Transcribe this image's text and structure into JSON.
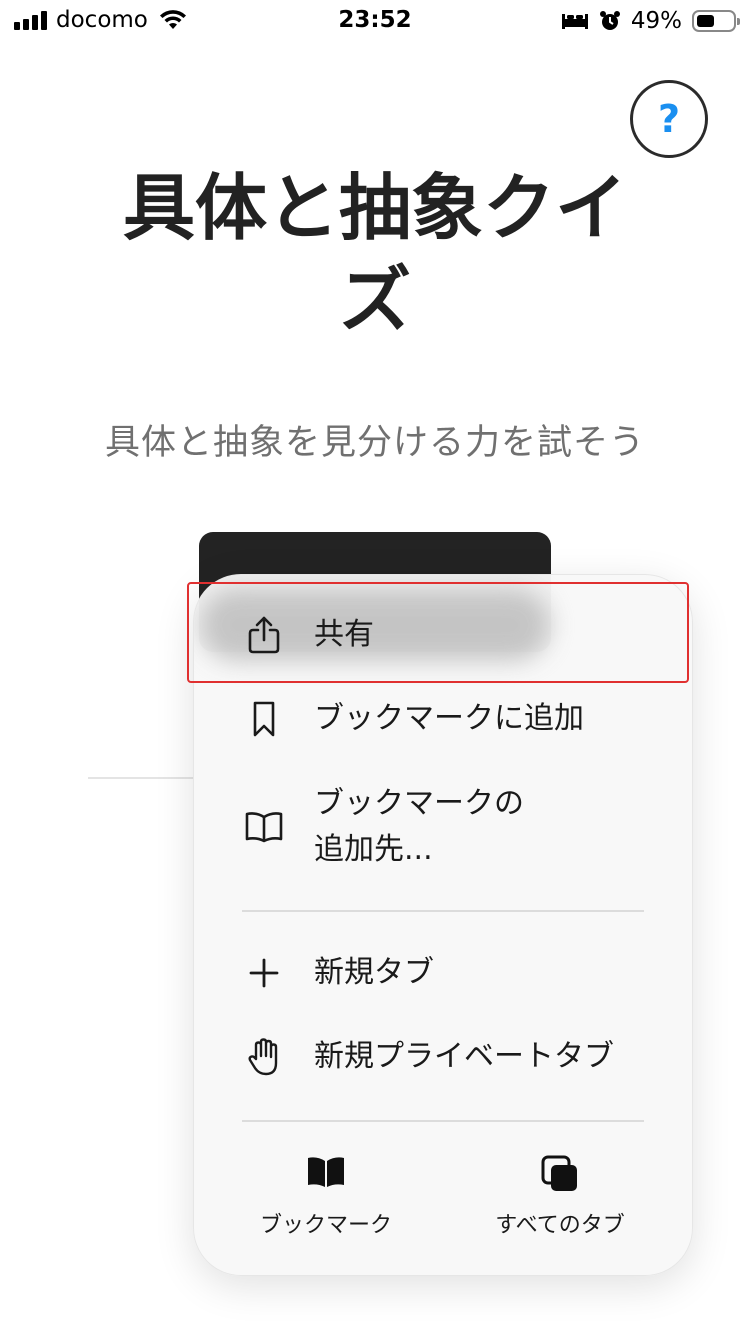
{
  "status_bar": {
    "carrier": "docomo",
    "time": "23:52",
    "battery": "49%",
    "battery_level": 0.49,
    "icons": [
      "signal-icon",
      "wifi-icon",
      "sleep-icon",
      "alarm-icon",
      "battery-icon"
    ]
  },
  "page": {
    "help_label": "?",
    "title": "具体と抽象クイズ",
    "subtitle": "具体と抽象を見分ける力を試そう",
    "accent_color": "#1a8ff0"
  },
  "context_menu": {
    "items": [
      {
        "label": "共有",
        "icon": "share-icon"
      },
      {
        "label": "ブックマークに追加",
        "icon": "bookmark-icon"
      },
      {
        "label": "ブックマークの\n追加先...",
        "icon": "open-book-icon"
      },
      {
        "label": "新規タブ",
        "icon": "plus-icon"
      },
      {
        "label": "新規プライベートタブ",
        "icon": "hand-icon"
      }
    ],
    "bottom": [
      {
        "label": "ブックマーク",
        "icon": "bookmarks-book-icon"
      },
      {
        "label": "すべてのタブ",
        "icon": "tabs-icon"
      }
    ],
    "selected_item": "共有",
    "selection_color": "#e03030"
  }
}
